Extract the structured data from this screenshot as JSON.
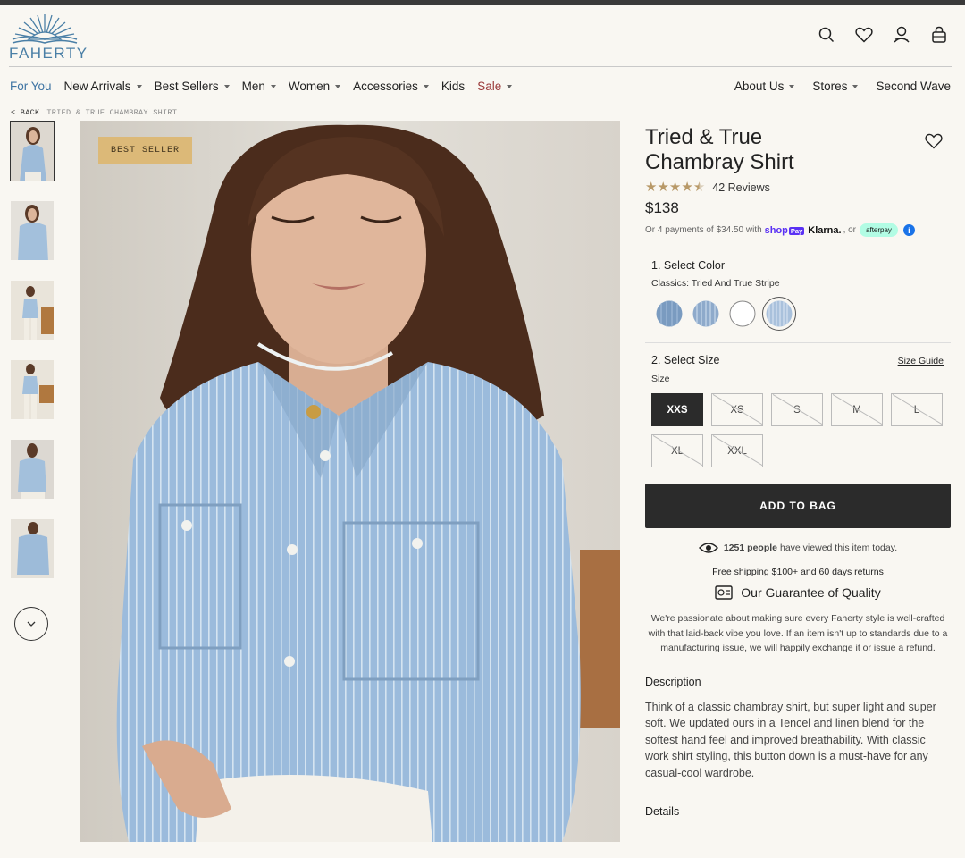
{
  "header": {
    "logo_text": "FAHERTY",
    "icons": [
      "search-icon",
      "heart-icon",
      "account-icon",
      "bag-icon"
    ]
  },
  "nav": {
    "left": [
      {
        "label": "For You",
        "caret": false
      },
      {
        "label": "New Arrivals",
        "caret": true
      },
      {
        "label": "Best Sellers",
        "caret": true
      },
      {
        "label": "Men",
        "caret": true
      },
      {
        "label": "Women",
        "caret": true
      },
      {
        "label": "Accessories",
        "caret": true
      },
      {
        "label": "Kids",
        "caret": false
      },
      {
        "label": "Sale",
        "caret": true
      }
    ],
    "right": [
      {
        "label": "About Us",
        "caret": true
      },
      {
        "label": "Stores",
        "caret": true
      },
      {
        "label": "Second Wave",
        "caret": false
      }
    ]
  },
  "breadcrumb": {
    "back": "< BACK",
    "current": "TRIED & TRUE CHAMBRAY SHIRT"
  },
  "gallery": {
    "badge": "BEST SELLER",
    "thumbnail_count": 6,
    "active_thumbnail": 1
  },
  "product": {
    "title": "Tried & True Chambray Shirt",
    "rating": 4.5,
    "reviews": "42 Reviews",
    "price": "$138",
    "payments": {
      "prefix": "Or 4 payments of $34.50 with",
      "shop": "shop",
      "shop_badge": "Pay",
      "klarna": "Klarna.",
      "or": ", or",
      "afterpay": "afterpay"
    }
  },
  "color": {
    "label": "1. Select Color",
    "selected_text": "Classics: Tried And True Stripe",
    "swatches": [
      "#7a9bc0",
      "#8eaacb",
      "#ffffff",
      "#a9c1dc"
    ],
    "selected_index": 3
  },
  "size": {
    "label": "2. Select Size",
    "guide": "Size Guide",
    "sub": "Size",
    "options": [
      {
        "label": "XXS",
        "available": true,
        "selected": true
      },
      {
        "label": "XS",
        "available": false,
        "selected": false
      },
      {
        "label": "S",
        "available": false,
        "selected": false
      },
      {
        "label": "M",
        "available": false,
        "selected": false
      },
      {
        "label": "L",
        "available": false,
        "selected": false
      },
      {
        "label": "XL",
        "available": false,
        "selected": false
      },
      {
        "label": "XXL",
        "available": false,
        "selected": false
      }
    ]
  },
  "cta": {
    "add_to_bag": "ADD TO BAG"
  },
  "info": {
    "viewed_count": "1251 people",
    "viewed_rest": "have viewed this item today.",
    "shipping": "Free shipping $100+ and 60 days returns",
    "guarantee_title": "Our Guarantee of Quality",
    "guarantee_text": "We're passionate about making sure every Faherty style is well-crafted with that laid-back vibe you love. If an item isn't up to standards due to a manufacturing issue, we will happily exchange it or issue a refund."
  },
  "description": {
    "heading": "Description",
    "text": "Think of a classic chambray shirt, but super light and super soft. We updated ours in a Tencel and linen blend for the softest hand feel and improved breathability. With classic work shirt styling, this button down is a must-have for any casual-cool wardrobe."
  },
  "details": {
    "heading": "Details"
  },
  "colors": {
    "link_blue": "#3f74a3",
    "sale_red": "#9b3a3a",
    "star_gold": "#b89968",
    "badge_gold": "#dcb978",
    "button_dark": "#2b2b2b",
    "background": "#f9f7f2"
  }
}
